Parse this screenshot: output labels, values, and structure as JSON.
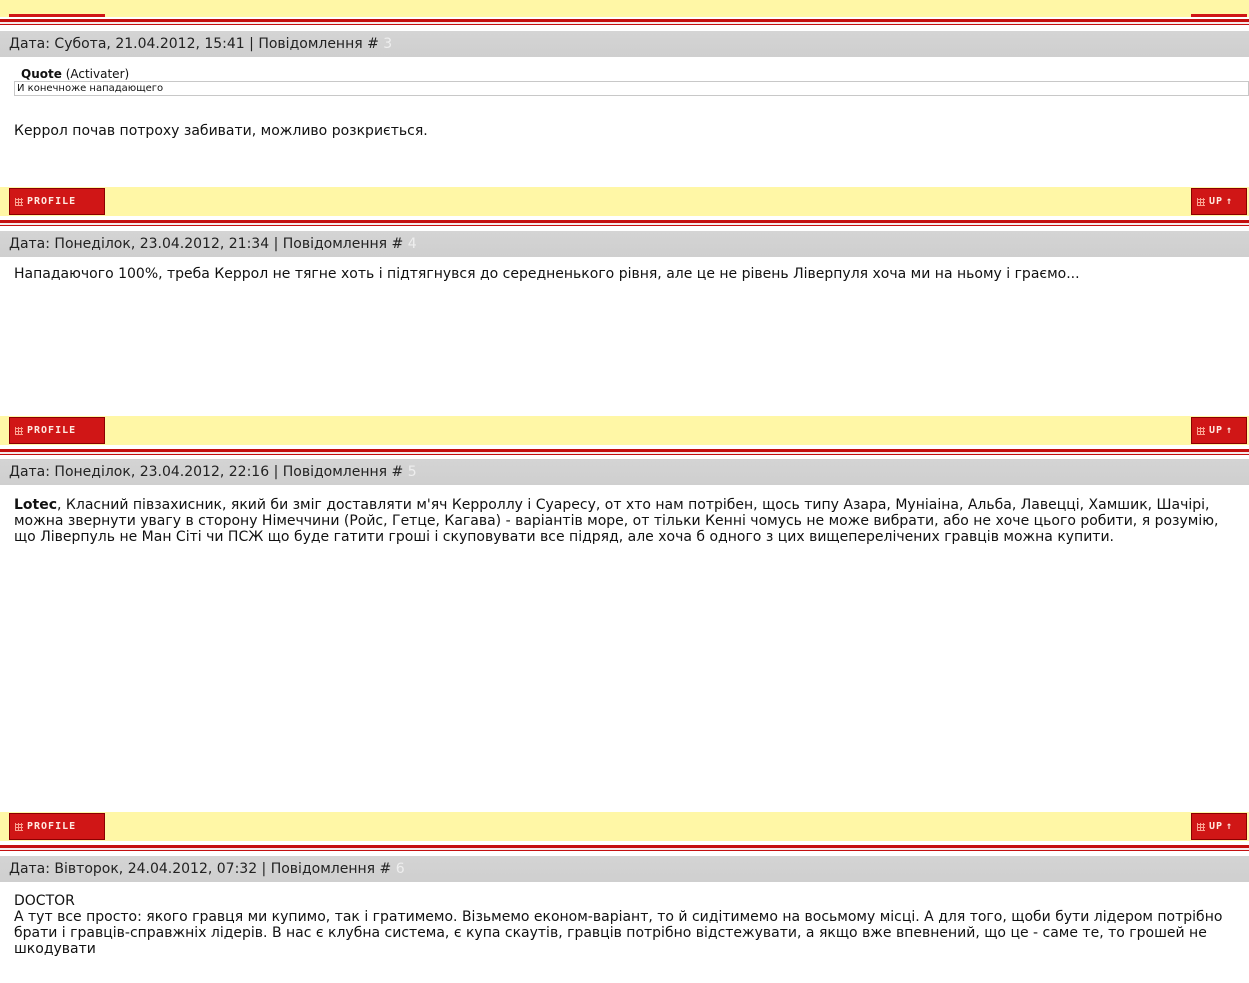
{
  "buttons": {
    "profile_label": "PROFILE",
    "up_label": "UP"
  },
  "colors": {
    "accent_red": "#c40f0f",
    "footer_yellow": "#fff7a6",
    "header_gray": "#d2d2d2"
  },
  "posts": [
    {
      "date_prefix": "Дата: Субота, 21.04.2012, 15:41 | Повідомлення # ",
      "number": "3",
      "quote_label": "Quote",
      "quote_author": "(Activater)",
      "quote_text": "И конечноже нападающего",
      "body": "Керрол почав потроху забивати, можливо розкриється."
    },
    {
      "date_prefix": "Дата: Понеділок, 23.04.2012, 21:34 | Повідомлення # ",
      "number": "4",
      "body": "Нападаючого 100%, треба Керрол не тягне хоть і підтягнувся до середненького рівня, але це не рівень Ліверпуля хоча ми на ньому і граємо..."
    },
    {
      "date_prefix": "Дата: Понеділок, 23.04.2012, 22:16 | Повідомлення # ",
      "number": "5",
      "mention": "Lotec",
      "body": ", Класний півзахисник, який би зміг доставляти м'яч Керроллу і Суаресу, от хто нам потрібен, щось типу Азара, Муніаіна, Альба, Лавецці, Хамшик, Шачірі, можна звернути увагу в сторону Німеччини (Ройс, Гетце, Кагава) - варіантів море, от тільки Кенні чомусь не може вибрати, або не хоче цього робити, я розумію, що Ліверпуль не Ман Сіті чи ПСЖ що буде гатити гроші і скуповувати все підряд, але хоча б одного з цих вищеперелічених гравців можна купити."
    },
    {
      "date_prefix": "Дата: Вівторок, 24.04.2012, 07:32 | Повідомлення # ",
      "number": "6",
      "mention": "DOCTOR",
      "body": "А тут все просто: якого гравця ми купимо, так і гратимемо. Візьмемо економ-варіант, то й сидітимемо на восьмому місці. А для того, щоби бути лідером потрібно брати і гравців-справжніх лідерів. В нас є клубна система, є купа скаутів, гравців потрібно відстежувати, а якщо вже впевнений, що це - саме те, то грошей не шкодувати"
    }
  ]
}
